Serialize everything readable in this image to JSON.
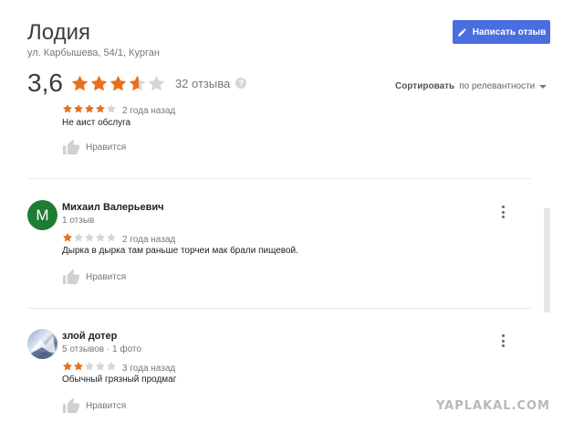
{
  "place": {
    "name": "Лодия",
    "address": "ул. Карбышева, 54/1, Курган"
  },
  "write_review_button": "Написать отзыв",
  "rating": {
    "value": "3,6",
    "stars": 3.6,
    "review_count": "32 отзыва",
    "help_icon": "?"
  },
  "sort": {
    "label": "Сортировать",
    "value": "по релевантности"
  },
  "colors": {
    "accent_button": "#4a6ee0",
    "star_filled": "#e7711b",
    "star_empty": "#d6d6d6",
    "avatar_green": "#1e7d32"
  },
  "reviews": [
    {
      "author": "",
      "meta": "",
      "stars": 4,
      "date": "2 года назад",
      "text": "Не аист обслуга",
      "like_label": "Нравится"
    },
    {
      "author": "Михаил Валерьевич",
      "avatar_letter": "М",
      "meta": "1 отзыв",
      "stars": 1,
      "date": "2 года назад",
      "text": "Дырка в дырка там раньше торчеи мак брали пищевой.",
      "like_label": "Нравится"
    },
    {
      "author": "злой дотер",
      "meta": "5 отзывов · 1 фото",
      "stars": 2,
      "date": "3 года назад",
      "text": "Обычный грязный продмаг",
      "like_label": "Нравится"
    }
  ],
  "watermark": "YAPLAKAL.COM"
}
